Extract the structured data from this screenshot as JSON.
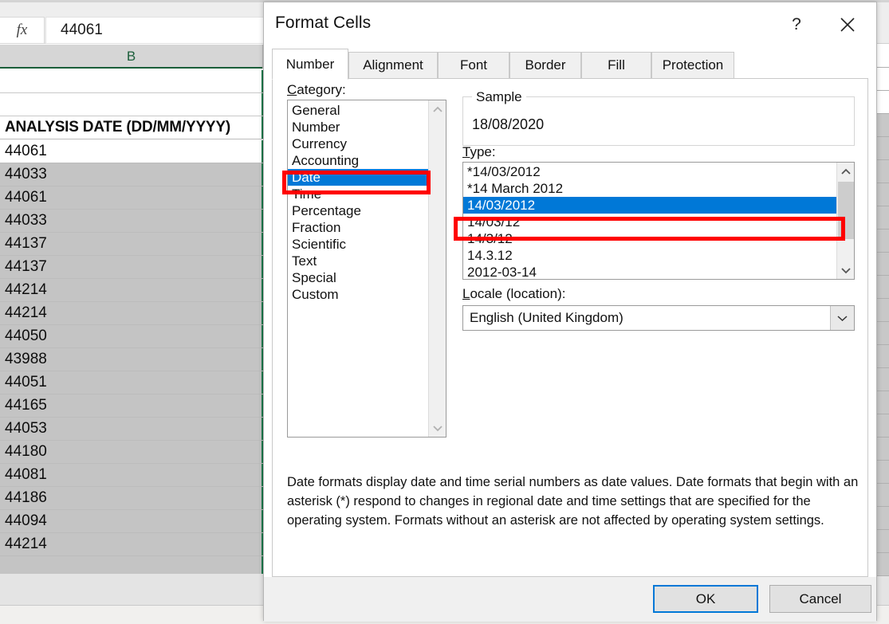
{
  "spreadsheet": {
    "formula_bar": {
      "fx_icon": "fx-icon",
      "value": "44061"
    },
    "columns": [
      {
        "label": "B"
      }
    ],
    "column_b_header": "ANALYSIS DATE (DD/MM/YYYY)",
    "cells": [
      "44061",
      "44033",
      "44061",
      "44033",
      "44137",
      "44137",
      "44214",
      "44214",
      "44050",
      "43988",
      "44051",
      "44165",
      "44053",
      "44180",
      "44081",
      "44186",
      "44094",
      "44214"
    ]
  },
  "dialog": {
    "title": "Format Cells",
    "help_label": "?",
    "close_label": "close-icon",
    "tabs": [
      {
        "label": "Number",
        "active": true
      },
      {
        "label": "Alignment",
        "active": false
      },
      {
        "label": "Font",
        "active": false
      },
      {
        "label": "Border",
        "active": false
      },
      {
        "label": "Fill",
        "active": false
      },
      {
        "label": "Protection",
        "active": false
      }
    ],
    "category": {
      "label": "Category:",
      "label_accel": "C",
      "label_rest": "ategory:",
      "items": [
        "General",
        "Number",
        "Currency",
        "Accounting",
        "Date",
        "Time",
        "Percentage",
        "Fraction",
        "Scientific",
        "Text",
        "Special",
        "Custom"
      ],
      "selected": "Date",
      "selected_index": 4
    },
    "sample": {
      "legend": "Sample",
      "value": "18/08/2020"
    },
    "type": {
      "label_accel": "T",
      "label_rest": "ype:",
      "items": [
        "*14/03/2012",
        "*14 March 2012",
        "14/03/2012",
        "14/03/12",
        "14/3/12",
        "14.3.12",
        "2012-03-14"
      ],
      "selected": "14/03/2012",
      "selected_index": 2
    },
    "locale": {
      "label_accel": "L",
      "label_rest": "ocale (location):",
      "value": "English (United Kingdom)"
    },
    "description": "Date formats display date and time serial numbers as date values.  Date formats that begin with an asterisk (*) respond to changes in regional date and time settings that are specified for the operating system. Formats without an asterisk are not affected by operating system settings.",
    "buttons": {
      "ok": "OK",
      "cancel": "Cancel"
    }
  },
  "annotations": {
    "highlight_color": "#ff0000",
    "selection_color": "#0078d7",
    "boxes": [
      {
        "target": "category-item-date"
      },
      {
        "target": "type-item-14-03-2012"
      }
    ]
  }
}
